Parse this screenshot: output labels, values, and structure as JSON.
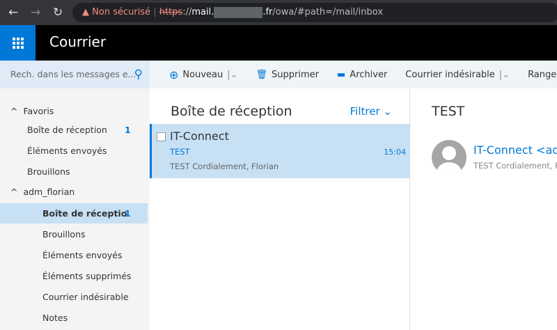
{
  "browser": {
    "warning": "Non sécurisé",
    "scheme": "https",
    "sep": "://",
    "host": "mail.",
    "tld": ".fr",
    "path": "/owa/#path=/mail/inbox"
  },
  "app": {
    "title": "Courrier"
  },
  "search": {
    "placeholder": "Rech. dans les messages e..."
  },
  "toolbar": {
    "new": "Nouveau",
    "delete": "Supprimer",
    "archive": "Archiver",
    "junk": "Courrier indésirable",
    "sweep": "Ranger"
  },
  "folders": {
    "favorites_label": "Favoris",
    "favorites": [
      {
        "label": "Boîte de réception",
        "count": "1"
      },
      {
        "label": "Éléments envoyés"
      },
      {
        "label": "Brouillons"
      }
    ],
    "account_label": "adm_florian",
    "account": [
      {
        "label": "Boîte de réceptio",
        "count": "1"
      },
      {
        "label": "Brouillons"
      },
      {
        "label": "Éléments envoyés"
      },
      {
        "label": "Éléments supprimés"
      },
      {
        "label": "Courrier indésirable"
      },
      {
        "label": "Notes"
      }
    ]
  },
  "list": {
    "title": "Boîte de réception",
    "filter": "Filtrer",
    "messages": [
      {
        "sender": "IT-Connect",
        "subject": "TEST",
        "time": "15:04",
        "preview": "TEST Cordialement, Florian"
      }
    ]
  },
  "reading": {
    "subject": "TEST",
    "from": "IT-Connect <adm",
    "preview": "TEST Cordialement, Flor"
  }
}
